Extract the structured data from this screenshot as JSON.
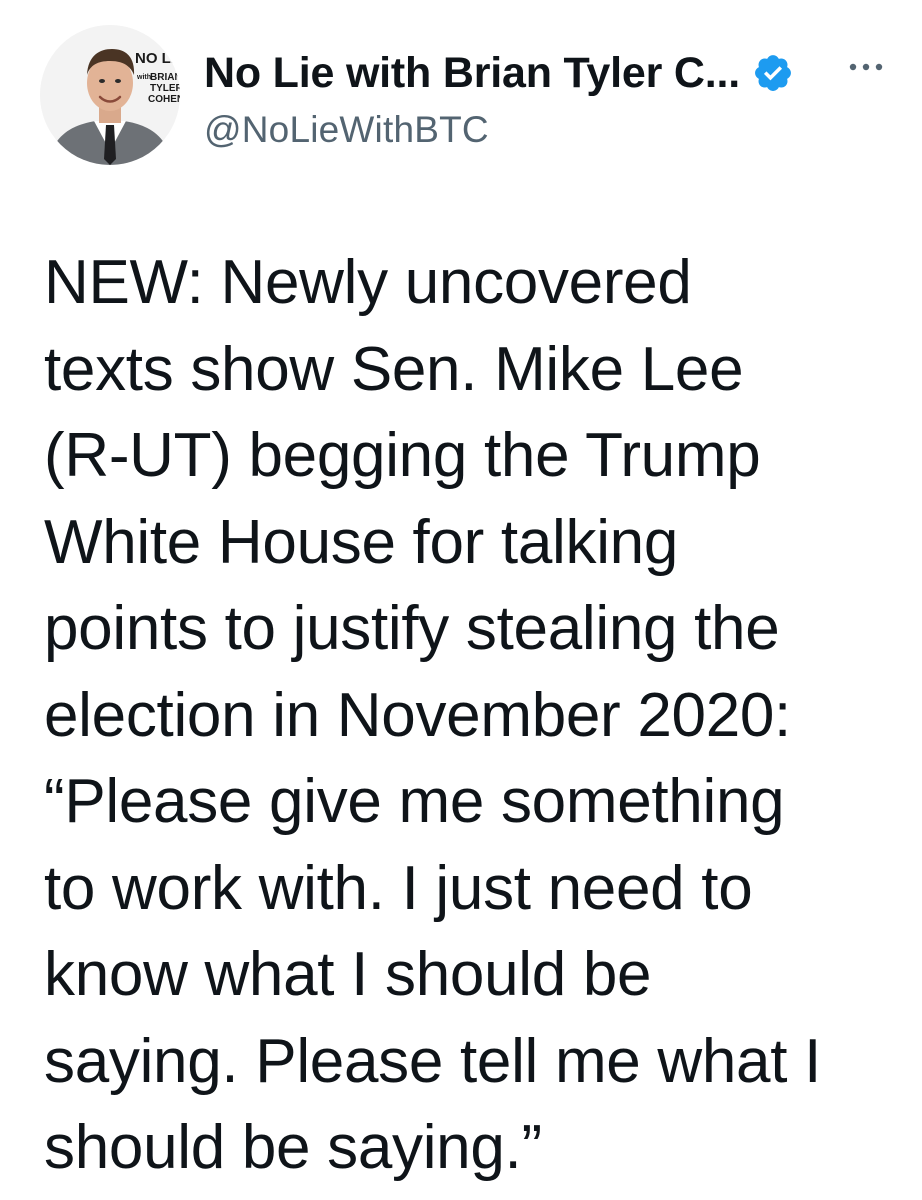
{
  "author": {
    "display_name": "No Lie with Brian Tyler C...",
    "handle": "@NoLieWithBTC",
    "verified": true,
    "avatar_logo": {
      "line1": "NO LIE",
      "line2": "with",
      "line3": "BRIAN",
      "line4": "TYLER",
      "line5": "COHEN"
    }
  },
  "icons": {
    "verified": "verified-badge-icon",
    "more": "more-options-icon"
  },
  "colors": {
    "text": "#0f1419",
    "secondary_text": "#536471",
    "verified_blue": "#1d9bf0",
    "background": "#ffffff"
  },
  "tweet": {
    "text": "NEW: Newly uncovered\ntexts show Sen. Mike Lee\n(R-UT) begging the Trump\nWhite House for talking\npoints to justify stealing the\nelection in November 2020:\n“Please give me something\nto work with. I just need to\nknow what I should be\nsaying. Please tell me what I\nshould be saying.”"
  }
}
